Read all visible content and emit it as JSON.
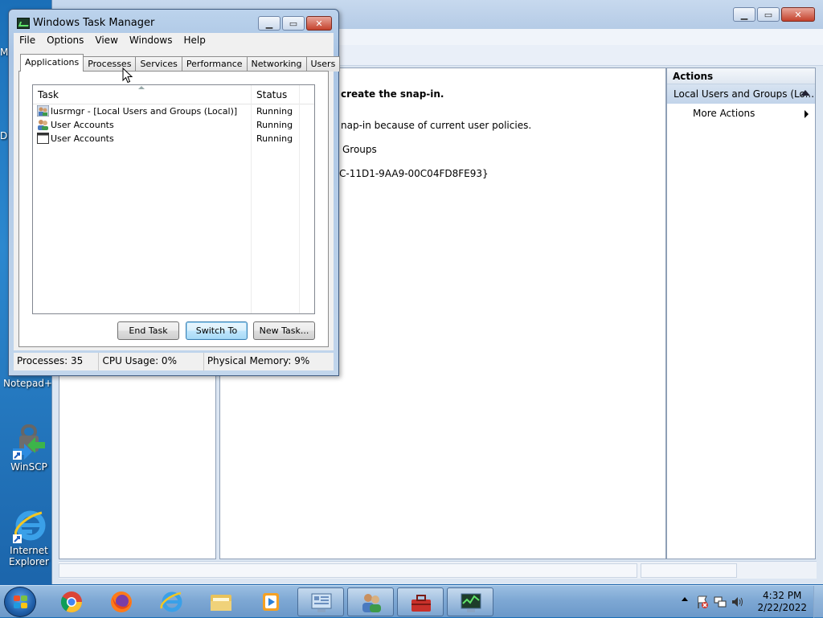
{
  "desktop": {
    "edge_texts": [
      "M",
      "D"
    ],
    "icons": [
      {
        "label": "Notepad++",
        "icon": "notepadplusplus-icon"
      },
      {
        "label": "WinSCP",
        "icon": "winscp-icon"
      },
      {
        "label": "Internet Explorer",
        "icon": "internet-explorer-icon"
      }
    ]
  },
  "mmc": {
    "center_lines": [
      "create the snap-in.",
      "nap-in because of current user policies.",
      "Groups",
      "C-11D1-9AA9-00C04FD8FE93}"
    ],
    "actions": {
      "header": "Actions",
      "section": "Local Users and Groups (Lo...",
      "items": [
        {
          "label": "More Actions"
        }
      ]
    }
  },
  "task_manager": {
    "title": "Windows Task Manager",
    "menu": [
      "File",
      "Options",
      "View",
      "Windows",
      "Help"
    ],
    "tabs": [
      "Applications",
      "Processes",
      "Services",
      "Performance",
      "Networking",
      "Users"
    ],
    "active_tab": "Applications",
    "columns": [
      "Task",
      "Status"
    ],
    "rows": [
      {
        "task": "lusrmgr - [Local Users and Groups (Local)]",
        "status": "Running",
        "icon": "lusrmgr-icon"
      },
      {
        "task": "User Accounts",
        "status": "Running",
        "icon": "user-accounts-icon"
      },
      {
        "task": "User Accounts",
        "status": "Running",
        "icon": "window-icon"
      }
    ],
    "buttons": {
      "end_task": "End Task",
      "switch_to": "Switch To",
      "new_task": "New Task..."
    },
    "status": {
      "processes": "Processes: 35",
      "cpu": "CPU Usage: 0%",
      "memory": "Physical Memory: 9%"
    }
  },
  "taskbar": {
    "pinned": [
      "chrome-icon",
      "firefox-icon",
      "internet-explorer-icon",
      "file-explorer-icon",
      "media-player-icon"
    ],
    "open": [
      "computer-management-icon",
      "user-accounts-icon",
      "toolbox-icon",
      "task-manager-icon"
    ],
    "time": "4:32 PM",
    "date": "2/22/2022"
  }
}
